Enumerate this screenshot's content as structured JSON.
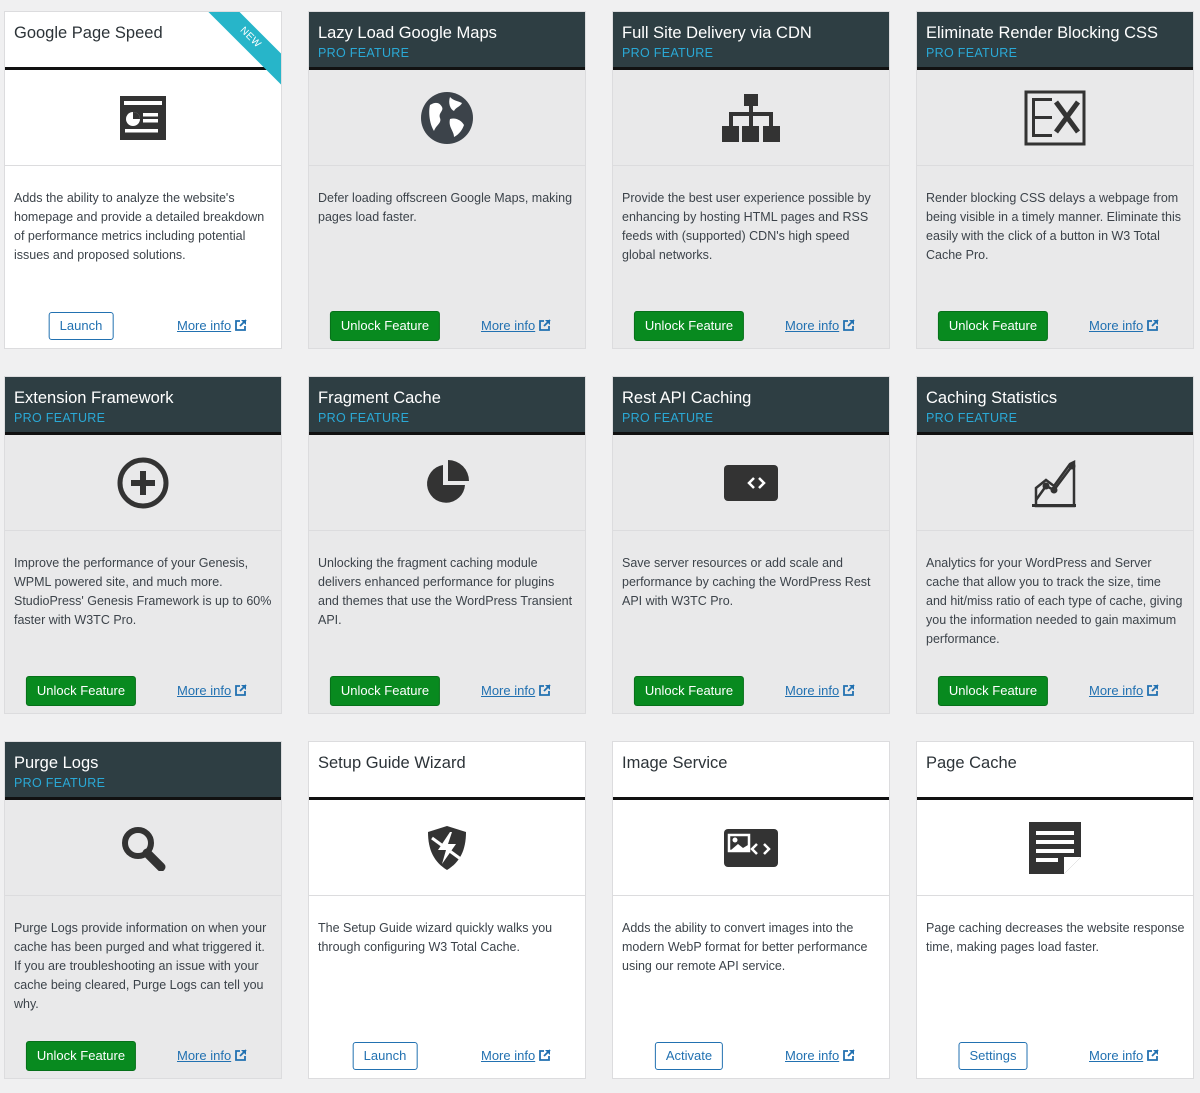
{
  "cards": [
    {
      "title": "Google Page Speed",
      "subtitle": "",
      "pro": false,
      "badge": "NEW",
      "icon": "page-speed-icon",
      "description": "Adds the ability to analyze the website's homepage and provide a detailed breakdown of performance metrics including potential issues and proposed solutions.",
      "button": "Launch",
      "more_info": "More info"
    },
    {
      "title": "Lazy Load Google Maps",
      "subtitle": "PRO FEATURE",
      "pro": true,
      "icon": "globe-icon",
      "description": "Defer loading offscreen Google Maps, making pages load faster.",
      "button": "Unlock Feature",
      "more_info": "More info"
    },
    {
      "title": "Full Site Delivery via CDN",
      "subtitle": "PRO FEATURE",
      "pro": true,
      "icon": "network-icon",
      "description": "Provide the best user experience possible by enhancing by hosting HTML pages and RSS feeds with (supported) CDN's high speed global networks.",
      "button": "Unlock Feature",
      "more_info": "More info"
    },
    {
      "title": "Eliminate Render Blocking CSS",
      "subtitle": "PRO FEATURE",
      "pro": true,
      "icon": "render-blocking-icon",
      "description": "Render blocking CSS delays a webpage from being visible in a timely manner. Eliminate this easily with the click of a button in W3 Total Cache Pro.",
      "button": "Unlock Feature",
      "more_info": "More info"
    },
    {
      "title": "Extension Framework",
      "subtitle": "PRO FEATURE",
      "pro": true,
      "icon": "plus-circle-icon",
      "description": "Improve the performance of your Genesis, WPML powered site, and much more. StudioPress' Genesis Framework is up to 60% faster with W3TC Pro.",
      "button": "Unlock Feature",
      "more_info": "More info"
    },
    {
      "title": "Fragment Cache",
      "subtitle": "PRO FEATURE",
      "pro": true,
      "icon": "pie-chart-icon",
      "description": "Unlocking the fragment caching module delivers enhanced performance for plugins and themes that use the WordPress Transient API.",
      "button": "Unlock Feature",
      "more_info": "More info"
    },
    {
      "title": "Rest API Caching",
      "subtitle": "PRO FEATURE",
      "pro": true,
      "icon": "code-block-icon",
      "description": "Save server resources or add scale and performance by caching the WordPress Rest API with W3TC Pro.",
      "button": "Unlock Feature",
      "more_info": "More info"
    },
    {
      "title": "Caching Statistics",
      "subtitle": "PRO FEATURE",
      "pro": true,
      "icon": "line-chart-icon",
      "description": "Analytics for your WordPress and Server cache that allow you to track the size, time and hit/miss ratio of each type of cache, giving you the information needed to gain maximum performance.",
      "button": "Unlock Feature",
      "more_info": "More info"
    },
    {
      "title": "Purge Logs",
      "subtitle": "PRO FEATURE",
      "pro": true,
      "icon": "search-icon",
      "description": "Purge Logs provide information on when your cache has been purged and what triggered it. If you are troubleshooting an issue with your cache being cleared, Purge Logs can tell you why.",
      "button": "Unlock Feature",
      "more_info": "More info"
    },
    {
      "title": "Setup Guide Wizard",
      "subtitle": "",
      "pro": false,
      "icon": "shield-icon",
      "description": "The Setup Guide wizard quickly walks you through configuring W3 Total Cache.",
      "button": "Launch",
      "more_info": "More info"
    },
    {
      "title": "Image Service",
      "subtitle": "",
      "pro": false,
      "icon": "image-code-icon",
      "description": "Adds the ability to convert images into the modern WebP format for better performance using our remote API service.",
      "button": "Activate",
      "more_info": "More info"
    },
    {
      "title": "Page Cache",
      "subtitle": "",
      "pro": false,
      "icon": "document-icon",
      "description": "Page caching decreases the website response time, making pages load faster.",
      "button": "Settings",
      "more_info": "More info"
    }
  ],
  "colors": {
    "pro_header": "#2e3e43",
    "pro_label": "#2aa9d6",
    "unlock_button": "#088a1f",
    "link": "#2271b1",
    "badge": "#27b5c9"
  }
}
